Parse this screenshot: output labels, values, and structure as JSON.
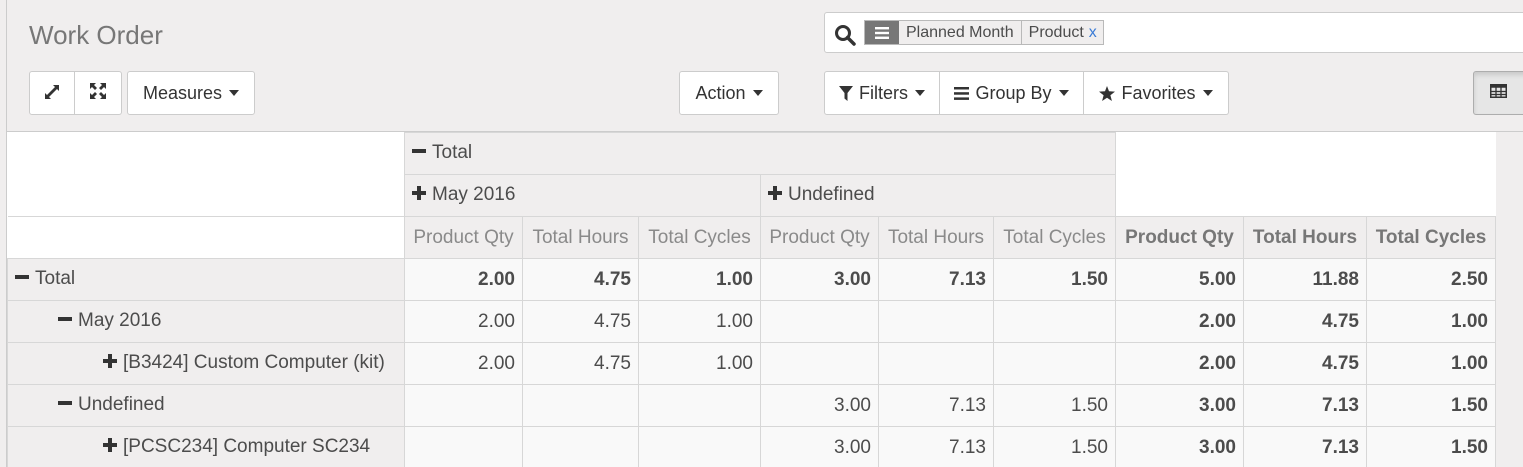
{
  "header": {
    "title": "Work Order"
  },
  "search": {
    "facets": [
      "Planned Month",
      "Product"
    ],
    "remove_label": "x"
  },
  "toolbar": {
    "measures_label": "Measures",
    "action_label": "Action",
    "filters_label": "Filters",
    "groupby_label": "Group By",
    "favorites_label": "Favorites"
  },
  "pivot": {
    "col_total_label": "Total",
    "col_groups": [
      "May 2016",
      "Undefined"
    ],
    "measures": [
      "Product Qty",
      "Total Hours",
      "Total Cycles"
    ],
    "rows": [
      {
        "label": "Total",
        "expanded": true,
        "values": [
          "2.00",
          "4.75",
          "1.00",
          "3.00",
          "7.13",
          "1.50",
          "5.00",
          "11.88",
          "2.50"
        ]
      },
      {
        "label": "May 2016",
        "expanded": true,
        "values": [
          "2.00",
          "4.75",
          "1.00",
          "",
          "",
          "",
          "2.00",
          "4.75",
          "1.00"
        ]
      },
      {
        "label": "[B3424] Custom Computer (kit)",
        "expanded": false,
        "values": [
          "2.00",
          "4.75",
          "1.00",
          "",
          "",
          "",
          "2.00",
          "4.75",
          "1.00"
        ]
      },
      {
        "label": "Undefined",
        "expanded": true,
        "values": [
          "",
          "",
          "",
          "3.00",
          "7.13",
          "1.50",
          "3.00",
          "7.13",
          "1.50"
        ]
      },
      {
        "label": "[PCSC234] Computer SC234",
        "expanded": false,
        "values": [
          "",
          "",
          "",
          "3.00",
          "7.13",
          "1.50",
          "3.00",
          "7.13",
          "1.50"
        ]
      }
    ]
  }
}
